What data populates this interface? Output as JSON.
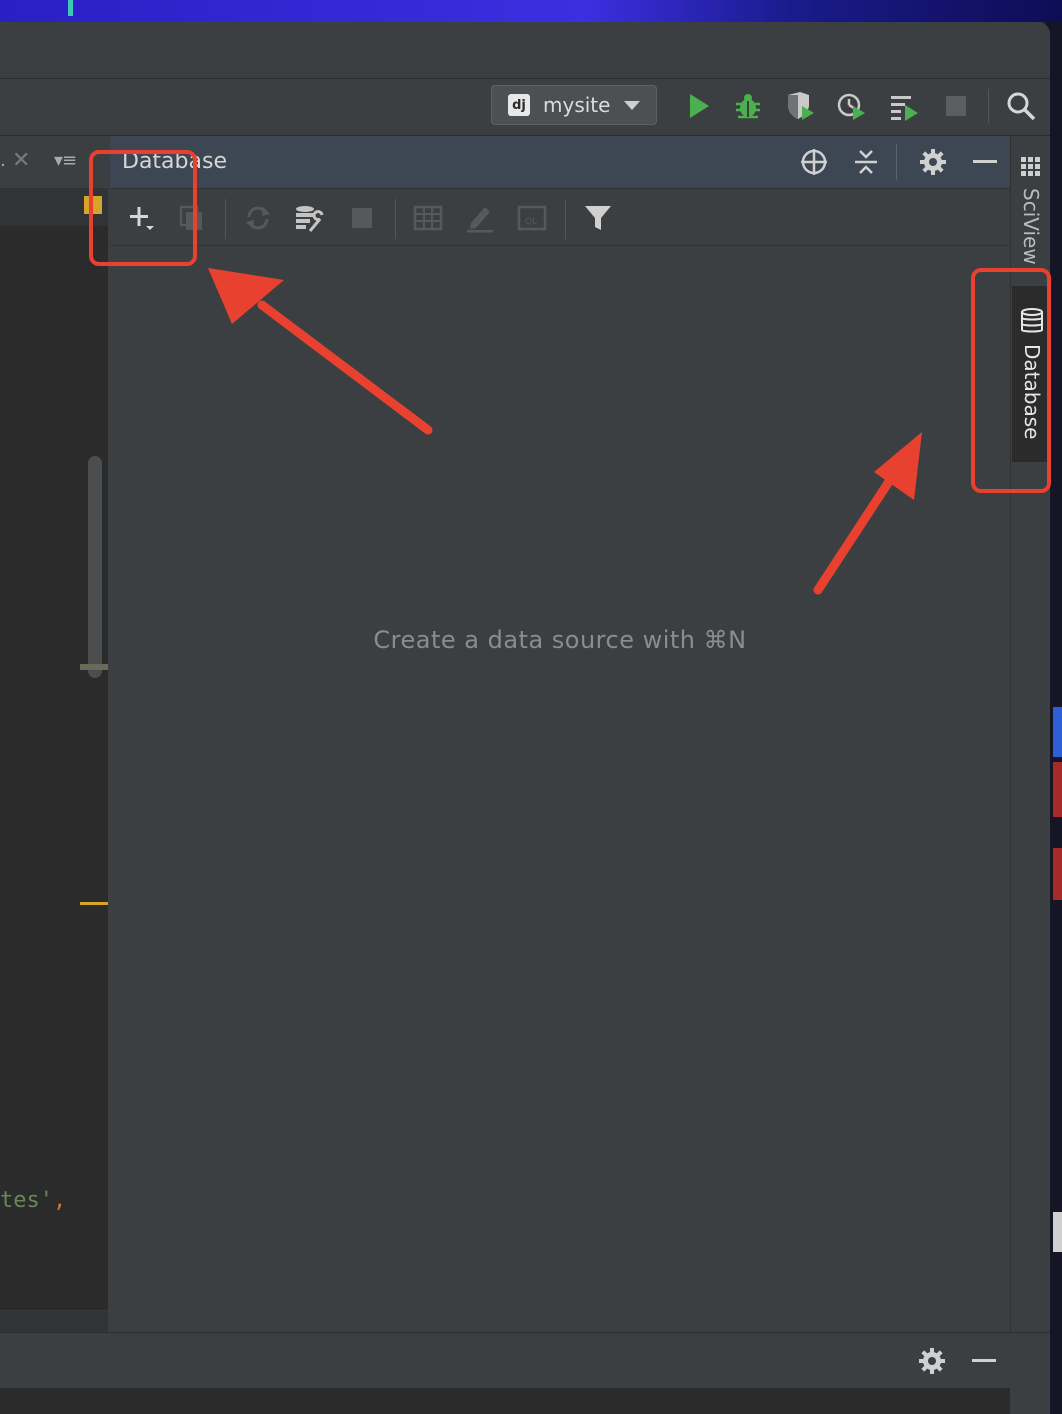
{
  "toolbar": {
    "run_config": {
      "badge": "dj",
      "label": "mysite"
    }
  },
  "editor": {
    "code_fragment": "tes'",
    "code_comma": ","
  },
  "db_panel": {
    "title": "Database",
    "empty_hint": "Create a data source with ⌘N"
  },
  "right_strip": {
    "sciview_label": "SciView",
    "database_label": "Database"
  },
  "icons": {
    "toolbar": [
      "run-icon",
      "debug-icon",
      "coverage-icon",
      "profile-icon",
      "concurrency-icon",
      "stop-icon",
      "search-icon"
    ],
    "db_header": [
      "locate-icon",
      "collapse-all-icon",
      "gear-icon",
      "minimize-icon"
    ],
    "db_toolbar": [
      "add-icon",
      "duplicate-icon",
      "refresh-icon",
      "data-source-properties-icon",
      "stop-icon",
      "table-icon",
      "edit-icon",
      "query-console-icon",
      "filter-icon"
    ]
  },
  "colors": {
    "run_green": "#4caf50",
    "annotation_red": "#e8412f",
    "header_bg": "#3d4754"
  }
}
